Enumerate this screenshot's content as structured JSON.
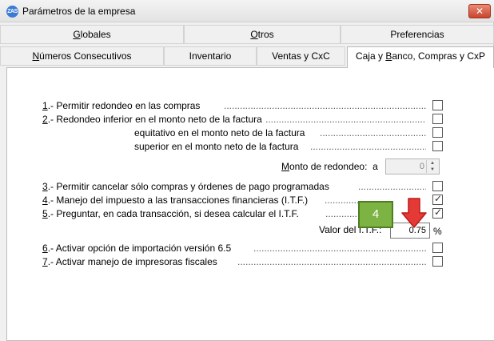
{
  "window": {
    "title": "Parámetros de la empresa",
    "app_icon_text": "ZAS",
    "close_label": "✕"
  },
  "tabs_row1": [
    {
      "label": "Globales",
      "accel": "G"
    },
    {
      "label": "Otros",
      "accel": "O"
    },
    {
      "label": "Preferencias"
    }
  ],
  "tabs_row2": [
    {
      "label": "Números Consecutivos",
      "accel": "N"
    },
    {
      "label": "Inventario"
    },
    {
      "label": "Ventas y CxC"
    },
    {
      "label": "Caja y Banco, Compras y CxP",
      "active": true
    }
  ],
  "options": {
    "opt1": {
      "num": "1",
      "text": ".- Permitir redondeo en las compras",
      "checked": false
    },
    "opt2": {
      "num": "2",
      "text": ".- Redondeo inferior en el monto neto de la factura",
      "checked": false
    },
    "opt2b": {
      "text": "equitativo en el monto neto de la factura",
      "checked": false
    },
    "opt2c": {
      "text": "superior en el monto neto de la factura",
      "checked": false
    },
    "monto": {
      "label": "Monto de redondeo:",
      "accel": "M",
      "suffix": "a",
      "value": "0"
    },
    "opt3": {
      "num": "3",
      "text": ".- Permitir cancelar sólo compras y órdenes de pago programadas",
      "checked": false
    },
    "opt4": {
      "num": "4",
      "text": ".- Manejo del impuesto a las transacciones financieras (I.T.F.)",
      "checked": true
    },
    "opt5": {
      "num": "5",
      "text": ".- Preguntar, en cada transacción, si desea calcular el I.T.F.",
      "checked": true
    },
    "itf": {
      "label": "Valor del I.T.F.:",
      "value": "0.75",
      "unit": "%"
    },
    "opt6": {
      "num": "6",
      "text": ".- Activar opción de importación versión 6.5",
      "checked": false
    },
    "opt7": {
      "num": "7",
      "text": ".- Activar manejo de impresoras fiscales",
      "checked": false
    }
  },
  "annotation": {
    "step": "4",
    "badge_color": "#7cb342",
    "arrow_color": "#e53935"
  },
  "leader_dots": "............................................................................................................................................................"
}
